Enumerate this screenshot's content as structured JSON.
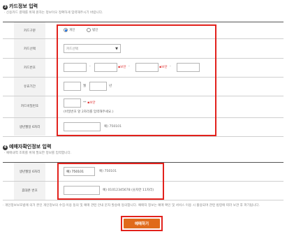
{
  "card_section": {
    "number": "3",
    "title": "카드정보 입력",
    "note": "· 신용카드 결제를 위해 원하는 정보이오 정확하게 입력해주시기 바랍니다.",
    "rows": {
      "card_type": {
        "label": "카드구분",
        "options": [
          {
            "label": "개인",
            "selected": true
          },
          {
            "label": "법인",
            "selected": false
          }
        ]
      },
      "card_select": {
        "label": "카드선택",
        "value": "카드선택"
      },
      "card_number": {
        "label": "카드번호",
        "mark": "보안"
      },
      "expiry": {
        "label": "유효기간",
        "month_unit": "월",
        "year_unit": "년"
      },
      "password": {
        "label": "카드비밀번호",
        "mask": "**",
        "mark": "보안",
        "hint": "(비밀번호 앞 2자리를 입력해주세요.)"
      },
      "birth": {
        "label": "생년월일 6자리",
        "example": "예) 750101"
      }
    }
  },
  "booker_section": {
    "number": "4",
    "title": "예매자확인정보 입력",
    "note": "· 예매내역 조회를 위해 필요한 정보를 입력합니다.",
    "rows": {
      "birth": {
        "label": "생년월일 6자리",
        "value": "예) 750101",
        "example": "예) 750101"
      },
      "phone": {
        "label": "휴대폰 번호",
        "example": "예) 01012345678 (숫자만 11자리)"
      }
    }
  },
  "consent_note": "· 개인정보보호법에 의거 본인 개인정보의 수집·이용 동의 및 예매 관련 안내 문자 발송에 동의합니다. 예매자 정보는 예매 확인 및 서비스 이용 시 활용되며 관련 법령에 따라 보관 후 파기됩니다.",
  "submit_label": "예매하기",
  "colors": {
    "highlight": "#e2211c",
    "button": "#e06a1b",
    "radio": "#1a73e8"
  }
}
